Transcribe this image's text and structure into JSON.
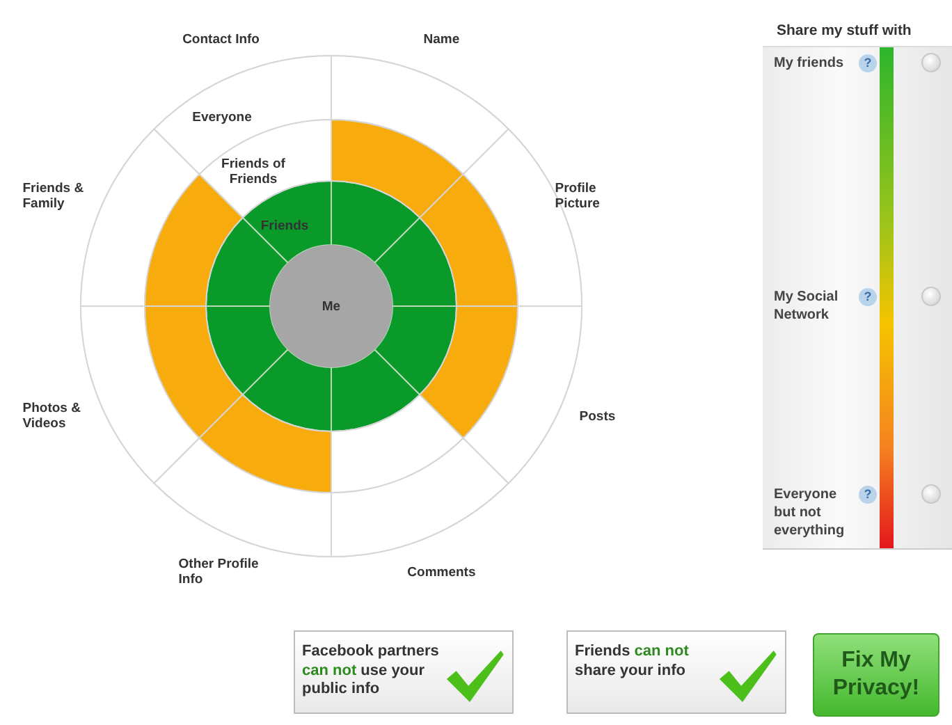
{
  "diagram": {
    "rings": [
      {
        "kind": "me",
        "label": "Me",
        "color": "#a6a6a6"
      },
      {
        "kind": "friends",
        "label": "Friends",
        "color": "#0a9a2a"
      },
      {
        "kind": "friends_of_friends",
        "label": "Friends of Friends",
        "color": "#f7ab0c"
      },
      {
        "kind": "everyone",
        "label": "Everyone"
      }
    ],
    "categories": [
      {
        "label": "Name",
        "segments": [
          {
            "shared": true
          },
          {
            "shared": true
          }
        ]
      },
      {
        "label": "Contact Info",
        "segments": [
          {
            "shared": true
          },
          {
            "shared": false
          }
        ]
      },
      {
        "label": "Friends & Family",
        "segments": [
          {
            "shared": true
          },
          {
            "shared": true
          }
        ]
      },
      {
        "label": "Photos & Videos",
        "segments": [
          {
            "shared": true
          },
          {
            "shared": true
          }
        ]
      },
      {
        "label": "Other Profile Info",
        "segments": [
          {
            "shared": true
          },
          {
            "shared": true
          }
        ]
      },
      {
        "label": "Comments",
        "segments": [
          {
            "shared": true
          },
          {
            "shared": false
          }
        ]
      },
      {
        "label": "Posts",
        "segments": [
          {
            "shared": true
          },
          {
            "shared": true
          }
        ]
      },
      {
        "label": "Profile Picture",
        "segments": [
          {
            "shared": true
          },
          {
            "shared": true
          }
        ]
      }
    ]
  },
  "sharing": {
    "title": "Share my stuff with",
    "options": [
      {
        "label": "My friends",
        "help": "?",
        "selected": false
      },
      {
        "label": "My Social Network",
        "help": "?",
        "selected": false
      },
      {
        "label": "Everyone but not everything",
        "help": "?",
        "selected": false
      }
    ]
  },
  "status_cards": [
    {
      "parts": [
        {
          "kind": "plain",
          "text": "Facebook partners "
        },
        {
          "kind": "highlight",
          "text": "can not"
        },
        {
          "kind": "plain",
          "text": " use your public info"
        }
      ],
      "checked": true
    },
    {
      "parts": [
        {
          "kind": "plain",
          "text": "Friends "
        },
        {
          "kind": "highlight",
          "text": "can not"
        },
        {
          "kind": "plain",
          "text": " share your info"
        }
      ],
      "checked": true
    }
  ],
  "fix_button": {
    "label": "Fix My Privacy!"
  }
}
